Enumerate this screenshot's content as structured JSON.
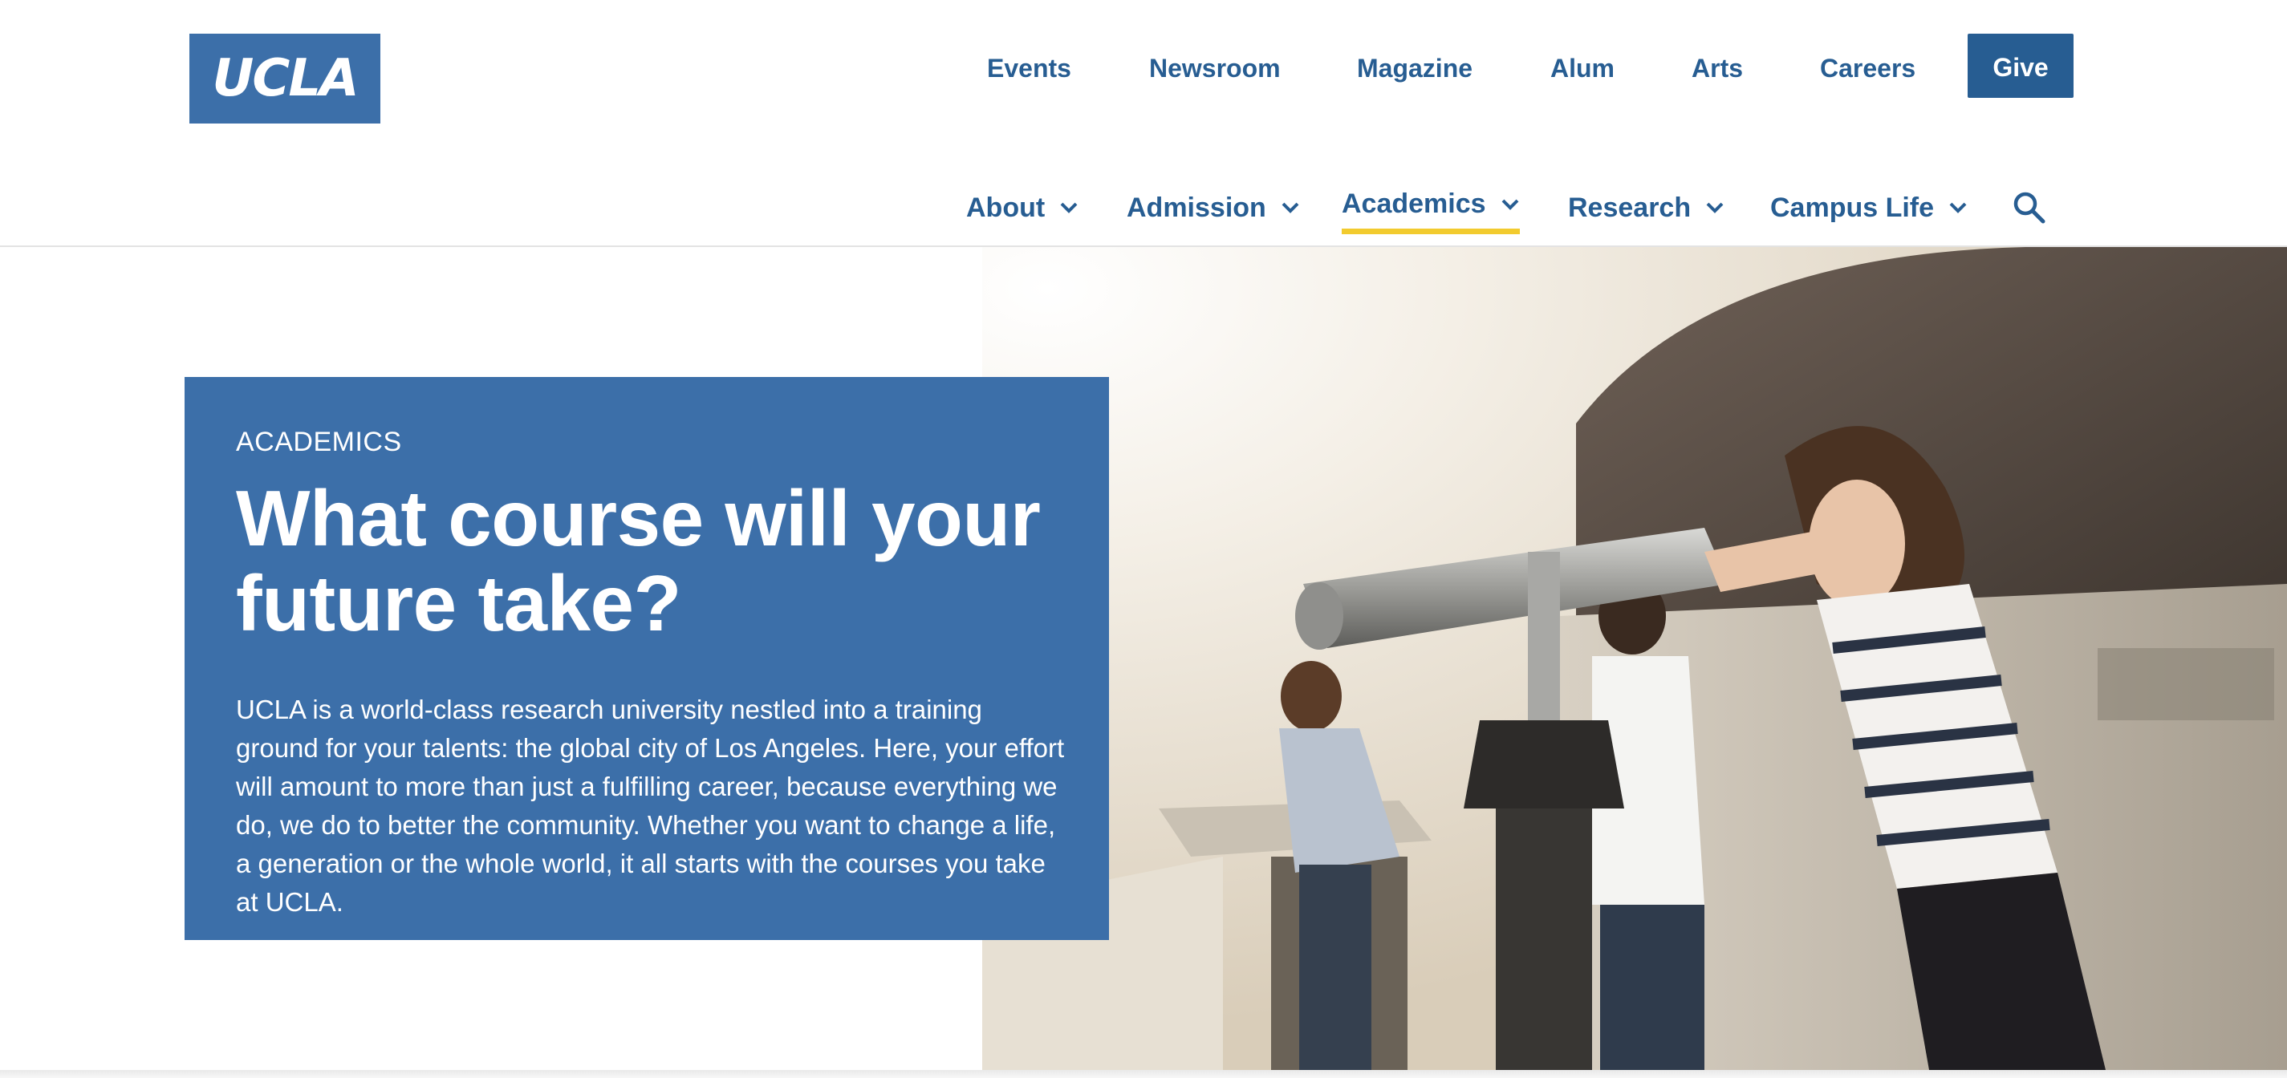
{
  "logo": {
    "text": "UCLA"
  },
  "utility_nav": {
    "links": [
      "Events",
      "Newsroom",
      "Magazine",
      "Alum",
      "Arts",
      "Careers"
    ],
    "give_label": "Give"
  },
  "main_nav": {
    "items": [
      {
        "label": "About",
        "has_dropdown": true,
        "active": false
      },
      {
        "label": "Admission",
        "has_dropdown": true,
        "active": false
      },
      {
        "label": "Academics",
        "has_dropdown": true,
        "active": true
      },
      {
        "label": "Research",
        "has_dropdown": true,
        "active": false
      },
      {
        "label": "Campus Life",
        "has_dropdown": true,
        "active": false
      }
    ],
    "search_icon": "search-icon",
    "active_underline_color": "#f2cb2e"
  },
  "hero": {
    "eyebrow": "ACADEMICS",
    "title_line1": "What course will your",
    "title_line2": "future take?",
    "body": "UCLA is a world-class research university nestled into a training ground for your talents: the global city of Los Angeles. Here, your effort will amount to more than just a fulfilling career, because everything we do, we do to better the community. Whether you want to change a life, a generation or the whole world, it all starts with the courses you take at UCLA."
  },
  "colors": {
    "brand_blue": "#3c6fa9",
    "nav_blue": "#275d92",
    "accent_gold": "#f2cb2e"
  }
}
